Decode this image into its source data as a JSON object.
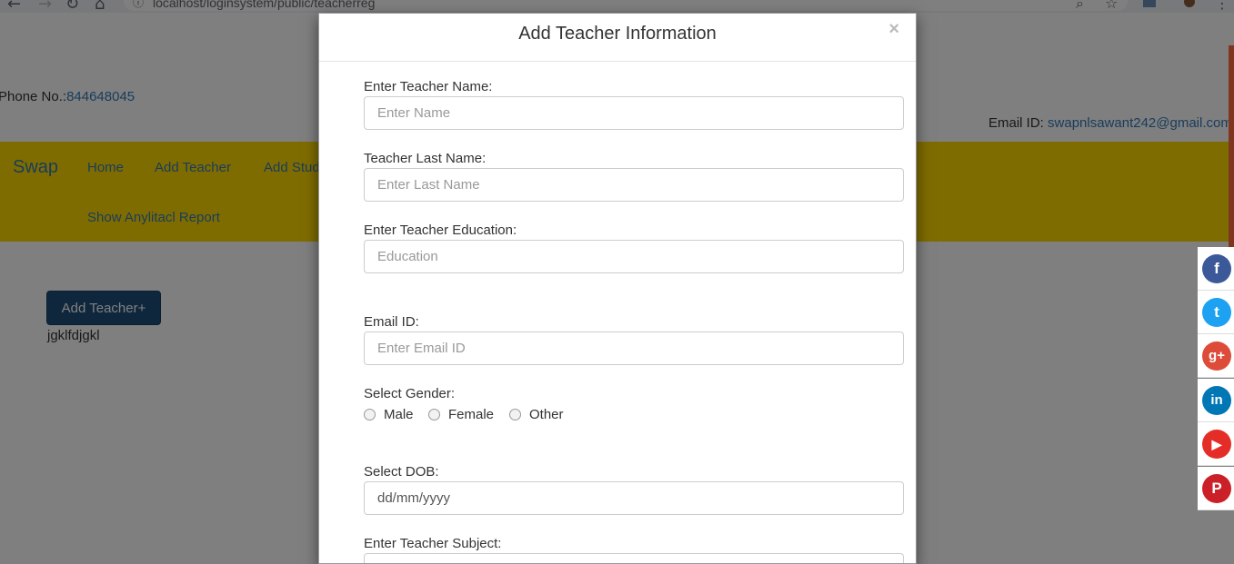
{
  "browser": {
    "url": "localhost/loginsystem/public/teacherreg",
    "back_icon": "←",
    "forward_icon": "→",
    "reload_icon": "↻",
    "home_icon": "⌂",
    "info_icon": "ⓘ",
    "zoom_icon": "⌕",
    "star_icon": "☆",
    "menu_icon": "⋮"
  },
  "header": {
    "phone_label": "Phone No.:",
    "phone_value": "844648045",
    "email_label": "Email ID: ",
    "email_value": "swapnlsawant242@gmail.com"
  },
  "navbar": {
    "brand": "Swap",
    "links": [
      "Home",
      "Add Teacher",
      "Add Student"
    ],
    "report_link": "Show Anylitacl Report",
    "color": "#ffd900"
  },
  "content": {
    "add_button": "Add Teacher+",
    "text": "jgklfdjgkl"
  },
  "social": {
    "facebook": "f",
    "twitter": "t",
    "googleplus": "g+",
    "linkedin": "in",
    "youtube": "▶",
    "pinterest": "P"
  },
  "modal": {
    "title": "Add Teacher Information",
    "close": "×",
    "fields": {
      "name_label": "Enter Teacher Name:",
      "name_placeholder": "Enter Name",
      "lastname_label": "Teacher Last Name:",
      "lastname_placeholder": "Enter Last Name",
      "education_label": "Enter Teacher Education:",
      "education_placeholder": "Education",
      "email_label": "Email ID:",
      "email_placeholder": "Enter Email ID",
      "gender_label": "Select Gender:",
      "gender_options": [
        "Male",
        "Female",
        "Other"
      ],
      "dob_label": "Select DOB:",
      "dob_value": "dd/mm/yyyy",
      "subject_label": "Enter Teacher Subject:"
    }
  }
}
